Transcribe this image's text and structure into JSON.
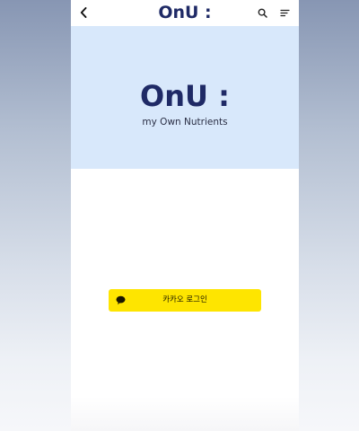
{
  "header": {
    "title": "OnU :",
    "back_icon": "chevron-left-icon",
    "search_icon": "search-icon",
    "menu_icon": "menu-lines-icon"
  },
  "hero": {
    "logo": "OnU :",
    "tagline": "my Own Nutrients"
  },
  "login": {
    "kakao_label": "카카오 로그인",
    "kakao_icon": "speech-bubble-icon"
  },
  "colors": {
    "brand_navy": "#1f2a66",
    "hero_background": "#d8e8fb",
    "kakao_yellow": "#fee500",
    "backdrop_top": "#8796b3",
    "backdrop_bottom": "#f6f7fa"
  }
}
